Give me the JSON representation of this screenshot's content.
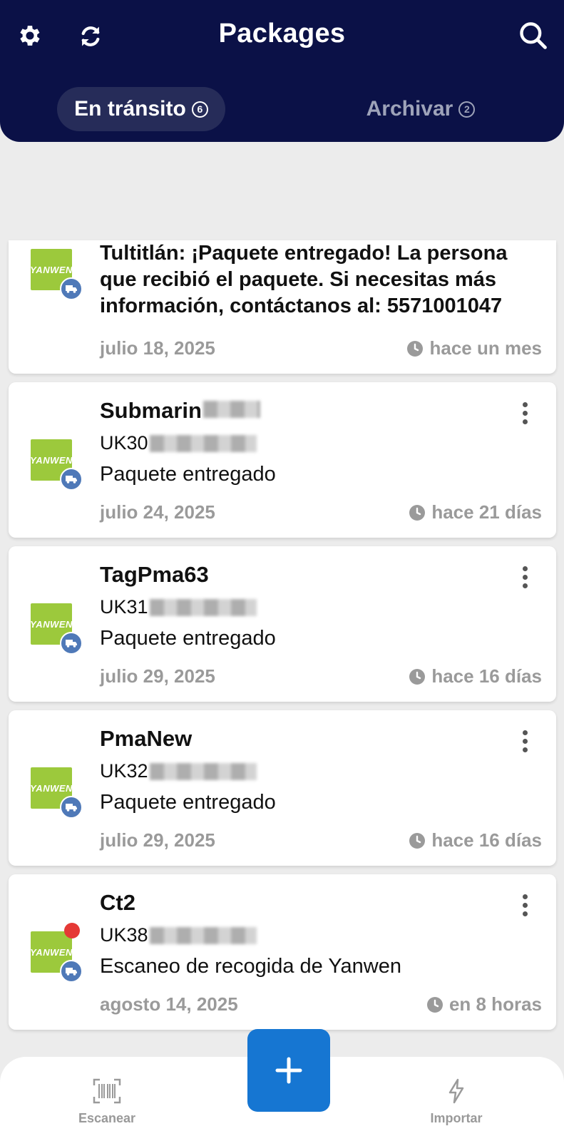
{
  "header": {
    "title": "Packages",
    "tabs": [
      {
        "label": "En tránsito",
        "count": "6"
      },
      {
        "label": "Archivar",
        "count": "2"
      }
    ]
  },
  "logo_text": "YANWEN",
  "packages": [
    {
      "event": "Tultitlán: ¡Paquete entregado! La persona que recibió el paquete. Si necesitas más información, contáctanos al: 5571001047",
      "date": "julio 18, 2025",
      "ago": "hace un mes"
    },
    {
      "name": "Submarin",
      "tracking": "UK30",
      "status": "Paquete entregado",
      "date": "julio 24, 2025",
      "ago": "hace 21 días"
    },
    {
      "name": "TagPma63",
      "tracking": "UK31",
      "status": "Paquete entregado",
      "date": "julio 29, 2025",
      "ago": "hace 16 días"
    },
    {
      "name": "PmaNew",
      "tracking": "UK32",
      "status": "Paquete entregado",
      "date": "julio 29, 2025",
      "ago": "hace 16 días"
    },
    {
      "name": "Ct2",
      "tracking": "UK38",
      "status": "Escaneo de recogida de Yanwen",
      "date": "agosto 14, 2025",
      "ago": "en 8 horas"
    }
  ],
  "bottom_nav": {
    "scan_label": "Escanear",
    "import_label": "Importar"
  },
  "colors": {
    "header_bg": "#0b1147",
    "logo_green": "#9cc93c",
    "truck_badge": "#4f79b8",
    "fab": "#1676d2",
    "unread_dot": "#e53935"
  }
}
